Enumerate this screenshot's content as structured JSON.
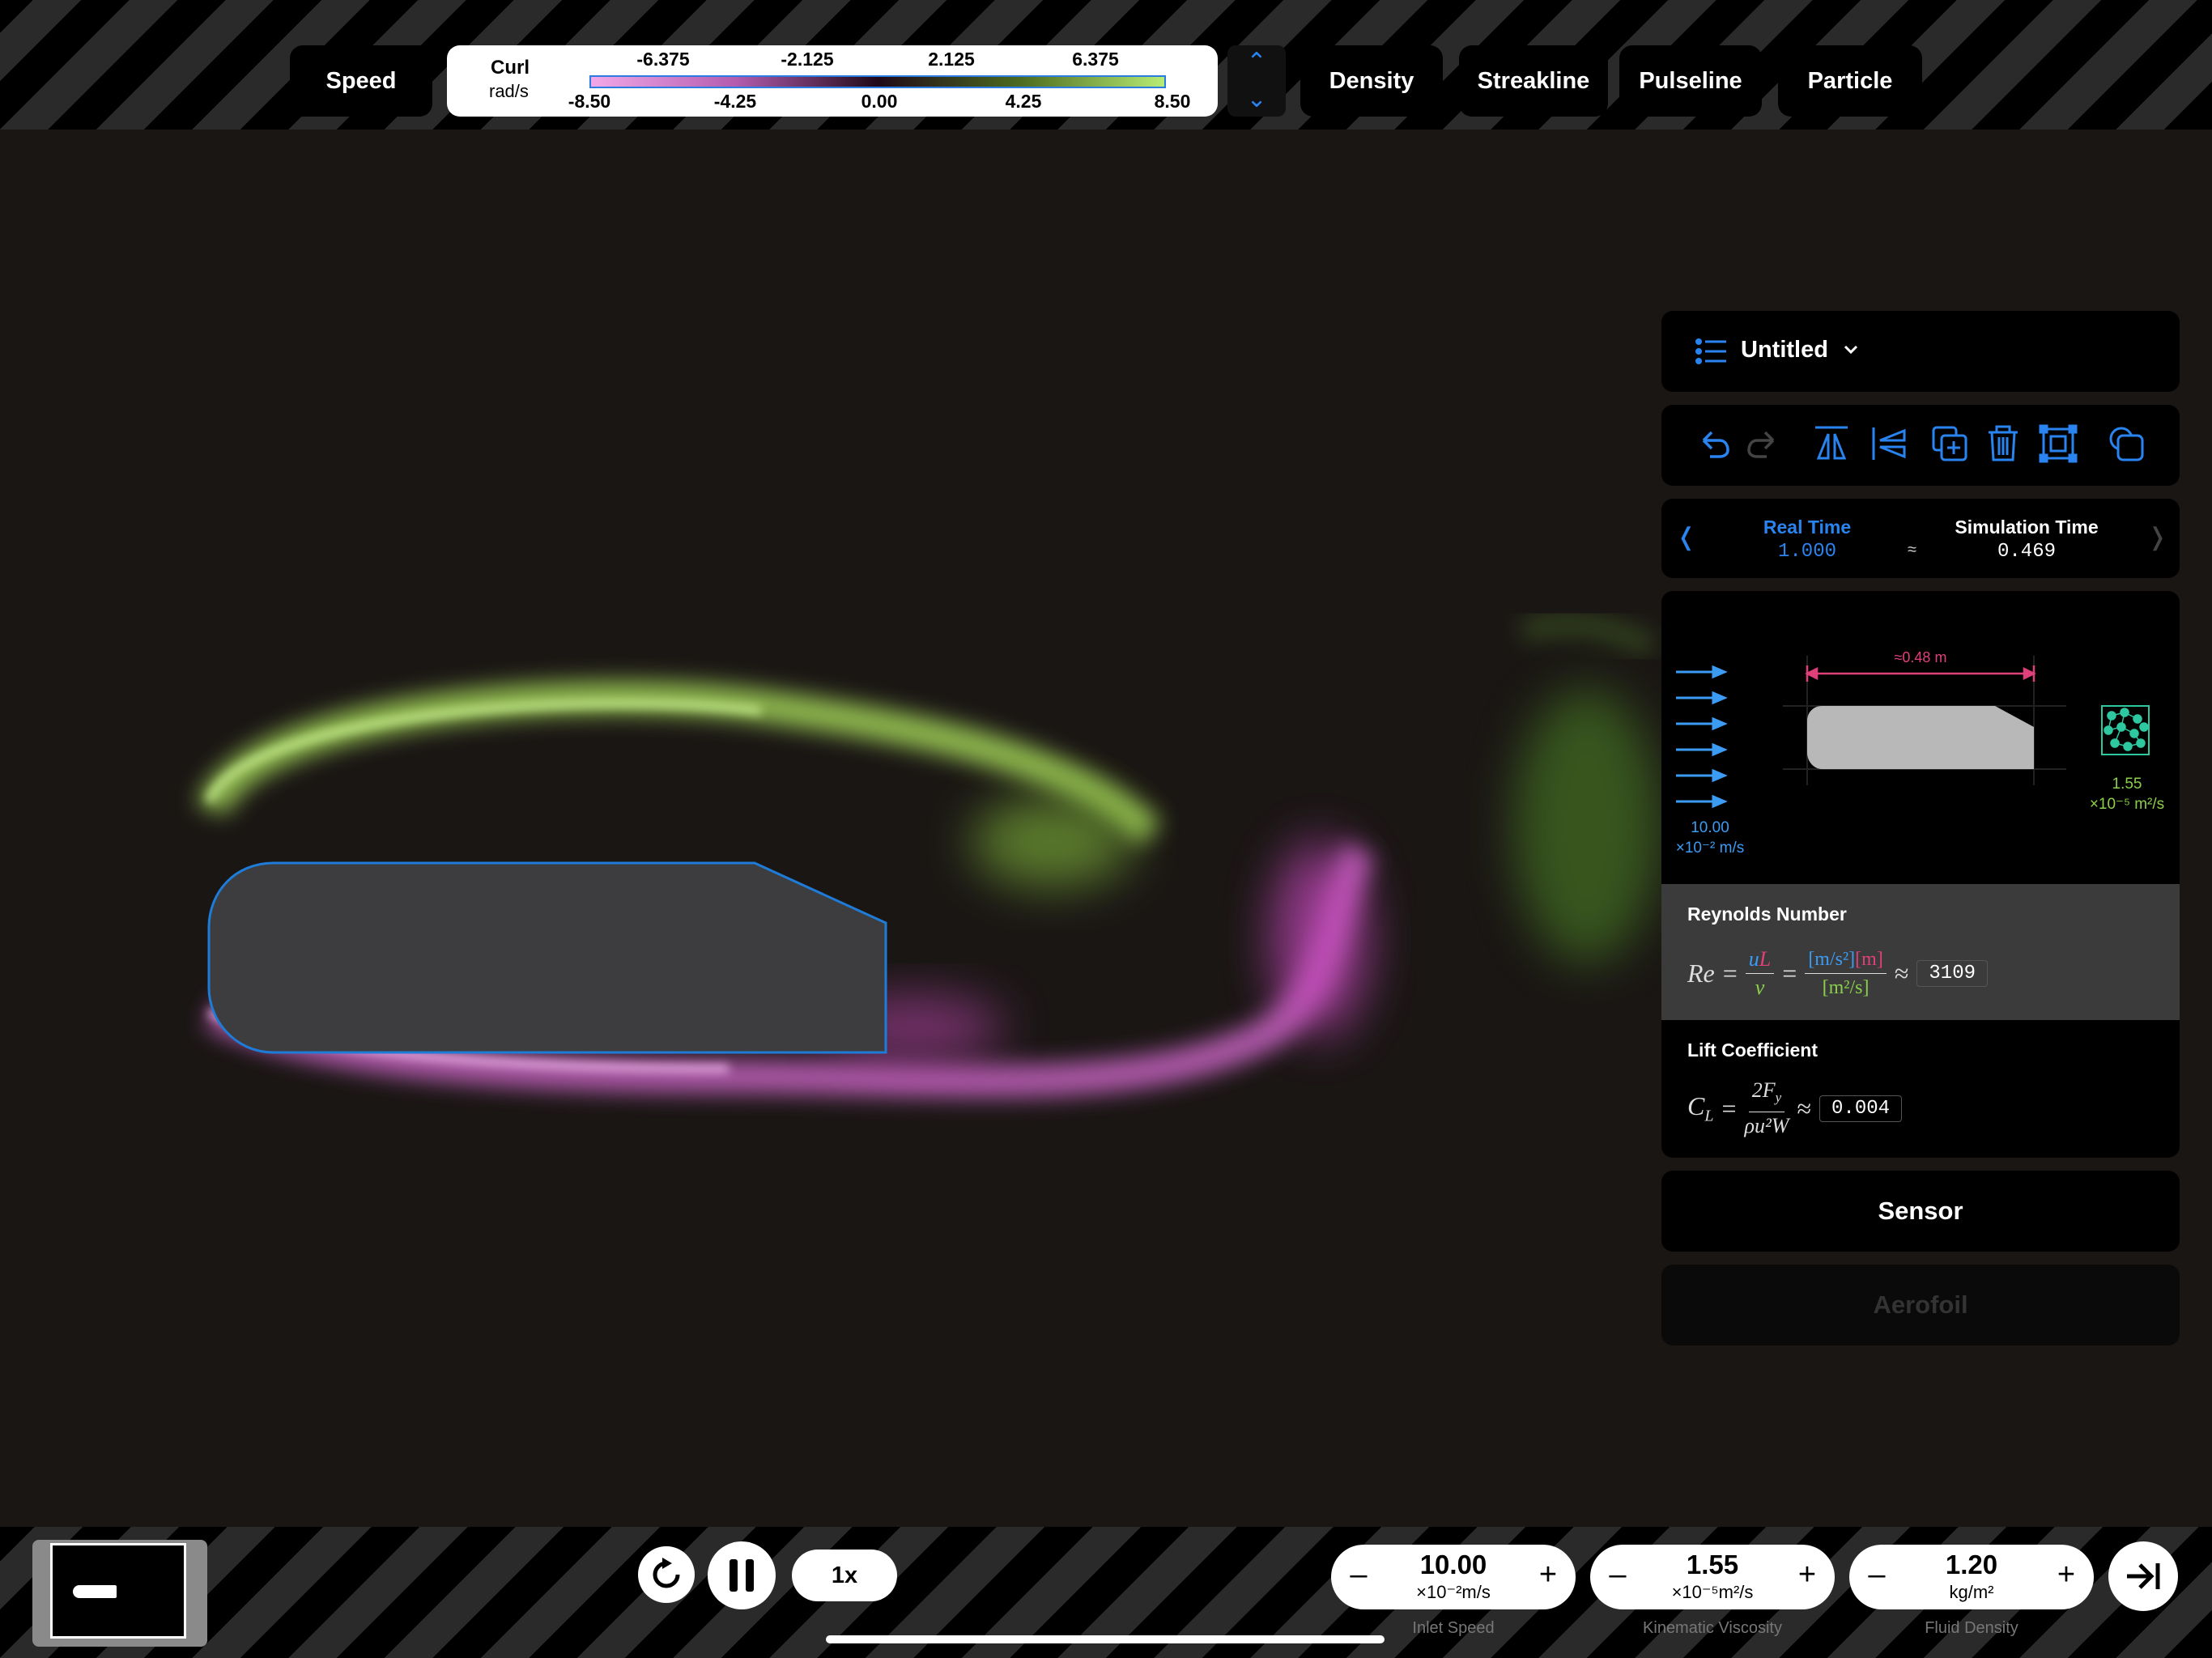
{
  "toolbar": {
    "mode_speed": "Speed",
    "mode_density": "Density",
    "mode_streakline": "Streakline",
    "mode_pulseline": "Pulseline",
    "mode_particle": "Particle"
  },
  "colorbar": {
    "title": "Curl",
    "unit": "rad/s",
    "top_ticks": [
      "-6.375",
      "-2.125",
      "2.125",
      "6.375"
    ],
    "bottom_ticks": [
      "-8.50",
      "-4.25",
      "0.00",
      "4.25",
      "8.50"
    ],
    "colors": {
      "negative": "#e88be0",
      "positive": "#a8e060",
      "zero": "#200918"
    }
  },
  "panel": {
    "project_title": "Untitled",
    "time": {
      "real_label": "Real Time",
      "real_value": "1.000",
      "approx": "≈",
      "sim_label": "Simulation Time",
      "sim_value": "0.469"
    },
    "diagram": {
      "length": "≈0.48 m",
      "inlet_value": "10.00",
      "inlet_unit": "×10⁻² m/s",
      "visc_value": "1.55",
      "visc_unit": "×10⁻⁵ m²/s"
    },
    "reynolds": {
      "title": "Reynolds Number",
      "value": "3109"
    },
    "lift": {
      "title": "Lift Coefficient",
      "value": "0.004"
    },
    "sensor_label": "Sensor",
    "aerofoil_label": "Aerofoil"
  },
  "controls": {
    "speed_multiplier": "1x",
    "inlet_speed": {
      "value": "10.00",
      "unit": "×10⁻²m/s",
      "label": "Inlet Speed"
    },
    "viscosity": {
      "value": "1.55",
      "unit": "×10⁻⁵m²/s",
      "label": "Kinematic Viscosity"
    },
    "density": {
      "value": "1.20",
      "unit": "kg/m²",
      "label": "Fluid Density"
    },
    "minus": "–",
    "plus": "+"
  },
  "icons": [
    "list-icon",
    "chevron-down-icon",
    "undo-icon",
    "redo-icon",
    "flip-vertical-icon",
    "flip-horizontal-icon",
    "duplicate-icon",
    "trash-icon",
    "select-frame-icon",
    "shape-icon",
    "chevron-left-icon",
    "chevron-right-icon",
    "reset-icon",
    "pause-icon",
    "collapse-panel-icon"
  ],
  "accent": "#2a84f0"
}
